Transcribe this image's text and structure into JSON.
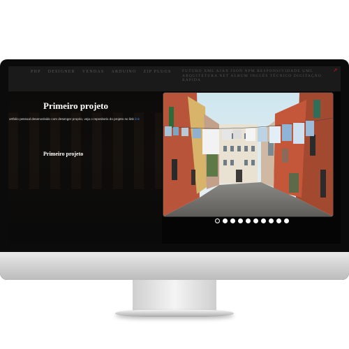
{
  "nav": {
    "left_items": [
      "PHP",
      "DESIGNER",
      "VENDAS",
      "ARDUINO",
      "ZIP PLUGS"
    ],
    "right_text": "FUTURO  XML  AJAX  JSON  NPM  RESPONSIVIDADE  UML  ARQUITETURA NET  ALBUM  INGLÊS TÉCNICO  DIGITAÇÃO RÁPIDA"
  },
  "hero": {
    "title": "Primeiro projeto",
    "description": "ortfolio pessoal desenvolvido com desenger proprio, veja o repositorio do projeto no link",
    "link_label": "link",
    "subtitle": "Primeiro projeto"
  },
  "carousel": {
    "slide_count": 10,
    "active_index": 0
  },
  "colors": {
    "accent_red": "#c0141d",
    "link_blue": "#3b7fd6"
  }
}
